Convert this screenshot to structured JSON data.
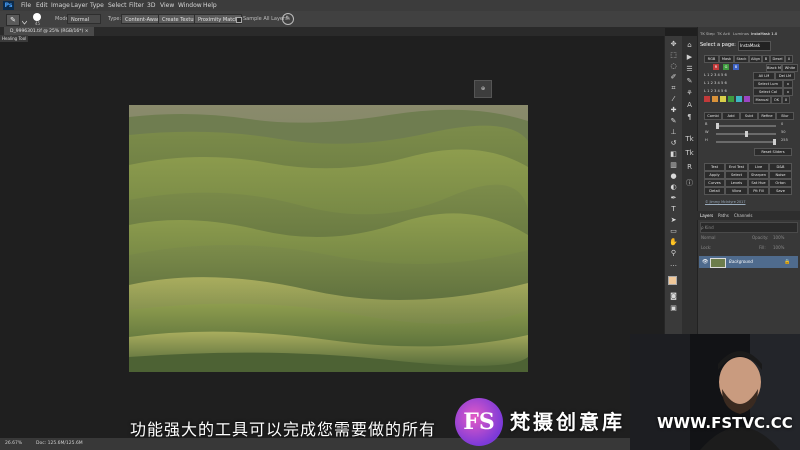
{
  "app": {
    "logo": "Ps"
  },
  "menu": [
    "File",
    "Edit",
    "Image",
    "Layer",
    "Type",
    "Select",
    "Filter",
    "3D",
    "View",
    "Window",
    "Help"
  ],
  "options": {
    "brush_size": "45",
    "mode_label": "Mode:",
    "mode_value": "Normal",
    "type_label": "Type:",
    "btn_content_aware": "Content-Aware",
    "btn_create_texture": "Create Texture",
    "btn_proximity_match": "Proximity Match",
    "sample_all_layers": "Sample All Layers"
  },
  "document": {
    "tab": "D_9996301.tif @ 25% (RGB/16*) ×",
    "tooltip": "Healing Tool"
  },
  "canvas": {
    "mini_label": "⊕"
  },
  "status": {
    "zoom": "26.67%",
    "doc": "Doc: 125.6M/125.6M"
  },
  "panel": {
    "tabs": [
      "TK Step",
      "TK Acti",
      "Luminos",
      "InstaMask 1.0"
    ],
    "select_page_label": "Select a page:",
    "select_page_value": "InstaMask",
    "row1": [
      "RGB",
      "Mask",
      "Stack",
      "Align",
      "B",
      "Desel",
      "X"
    ],
    "row2_chips": [
      "R",
      "G",
      "B"
    ],
    "row2_btns": [
      "Black M",
      "White M"
    ],
    "row3_btns": [
      "All LM",
      "Del LM"
    ],
    "row4_btns": [
      "Select Lum",
      "x"
    ],
    "row5_btns": [
      "Select Col",
      "x"
    ],
    "row6_btns": [
      "Manual",
      "OK",
      "X"
    ],
    "row2_nums": [
      "L",
      "1",
      "2",
      "3",
      "4",
      "5",
      "6"
    ],
    "combine_btns": [
      "Combi",
      "Add",
      "Subt",
      "Refine",
      "Blur"
    ],
    "slider_labels": [
      "B",
      "W",
      "H"
    ],
    "slider_values": [
      "0",
      "50",
      "255"
    ],
    "reset_sliders": "Reset Sliders",
    "grid": [
      [
        "Test",
        "End Test",
        "Live",
        "D&B"
      ],
      [
        "Apply",
        "Select",
        "Sharpen",
        "Noise"
      ],
      [
        "Curves",
        "Levels",
        "Sat Hue",
        "Orton"
      ],
      [
        "Detail",
        "Vibra",
        "Pit Fill",
        "Save"
      ]
    ],
    "credit": "© Jimmy McIntyre 2017"
  },
  "layers": {
    "tabs": [
      "Layers",
      "Paths",
      "Channels"
    ],
    "search_placeholder": "ρ Kind",
    "blend_mode": "Normal",
    "opacity_label": "Opacity:",
    "opacity_value": "100%",
    "lock_label": "Lock:",
    "fill_label": "Fill:",
    "fill_value": "100%",
    "layer_name": "Background"
  },
  "subtitle": "功能强大的工具可以完成您需要做的所有",
  "watermark": {
    "logo_text": "FS",
    "name": "梵摄创意库",
    "url": "WWW.FSTVC.CC"
  },
  "colors": {
    "panel_accent": "#4f6b8d",
    "chip_red": "#c23a3a",
    "chip_green": "#3f9b3f",
    "chip_blue": "#3e62c4"
  }
}
